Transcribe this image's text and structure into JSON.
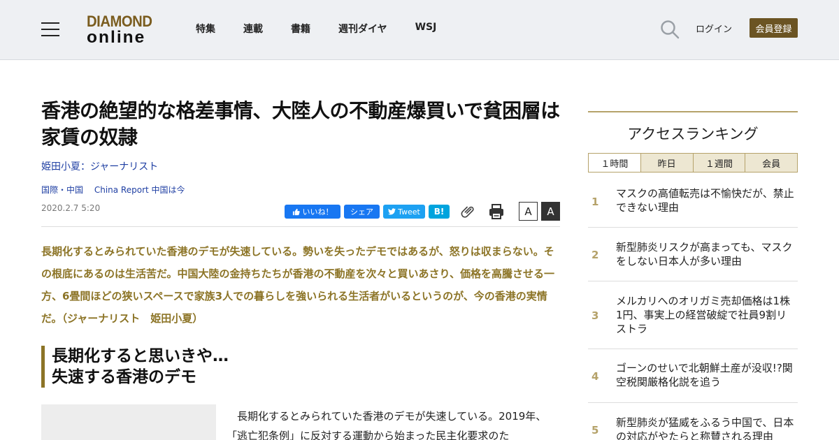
{
  "header": {
    "logo_top": "DIAMOND",
    "logo_bottom": "online",
    "nav": [
      "特集",
      "連載",
      "書籍",
      "週刊ダイヤ",
      "WSJ"
    ],
    "login": "ログイン",
    "register": "会員登録"
  },
  "article": {
    "title": "香港の絶望的な格差事情、大陸人の不動産爆買いで貧困層は家賃の奴隷",
    "author": "姫田小夏：ジャーナリスト",
    "categories": [
      "国際・中国",
      "China Report 中国は今"
    ],
    "date": "2020.2.7 5:20",
    "share": {
      "like": "いいね！",
      "share": "シェア",
      "tweet": "Tweet",
      "hatena": "B!"
    },
    "font_small": "A",
    "font_large": "A",
    "lead": "長期化するとみられていた香港のデモが失速している。勢いを失ったデモではあるが、怒りは収まらない。その根底にあるのは生活苦だ。中国大陸の金持ちたちが香港の不動産を次々と買いあさり、価格を高騰させる一方、6畳間ほどの狭いスペースで家族3人での暮らしを強いられる生活者がいるというのが、今の香港の実情だ。（ジャーナリスト　姫田小夏）",
    "subhead_line1": "長期化すると思いきや…",
    "subhead_line2": "失速する香港のデモ",
    "body": "長期化するとみられていた香港のデモが失速している。2019年、「逃亡犯条例」に反対する運動から始まった民主化要求のた"
  },
  "sidebar": {
    "ranking_title": "アクセスランキング",
    "tabs": [
      "１時間",
      "昨日",
      "１週間",
      "会員"
    ],
    "items": [
      {
        "rank": "1",
        "text": "マスクの高値転売は不愉快だが、禁止できない理由"
      },
      {
        "rank": "2",
        "text": "新型肺炎リスクが高まっても、マスクをしない日本人が多い理由"
      },
      {
        "rank": "3",
        "text": "メルカリへのオリガミ売却価格は1株1円、事実上の経営破綻で社員9割リストラ"
      },
      {
        "rank": "4",
        "text": "ゴーンのせいで北朝鮮土産が没収!?関空税関厳格化説を追う"
      },
      {
        "rank": "5",
        "text": "新型肺炎が猛威をふるう中国で、日本の対応がやたらと称賛される理由"
      }
    ]
  },
  "colors": {
    "brand_gold": "#8c7426",
    "register_bg": "#6b5423",
    "link_blue": "#1f3fa3"
  }
}
